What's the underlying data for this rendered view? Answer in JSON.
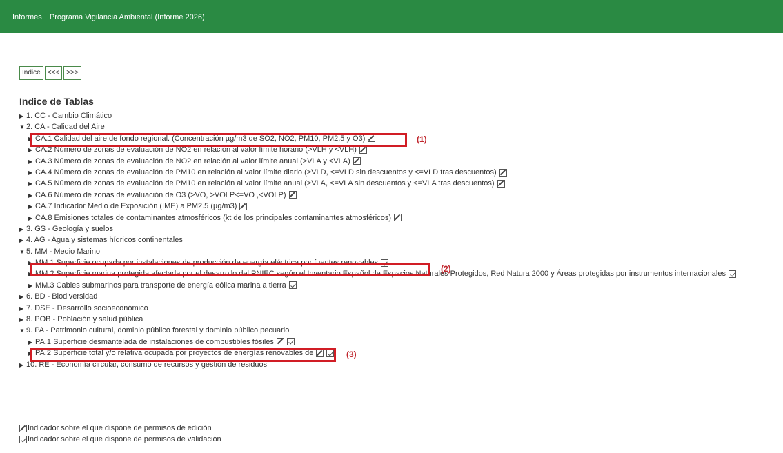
{
  "header": {
    "breadcrumb": [
      "Informes",
      "Programa Vigilancia Ambiental (Informe 2026)"
    ],
    "color": "#2a8a43"
  },
  "nav_buttons": [
    "Indice",
    "<<<",
    ">>>"
  ],
  "index_title": "Indice de Tablas",
  "tree": [
    {
      "level": 0,
      "expanded": false,
      "label": "1. CC - Cambio Climático"
    },
    {
      "level": 0,
      "expanded": true,
      "label": "2. CA - Calidad del Aire"
    },
    {
      "level": 1,
      "label": "CA.1 Calidad del aire de fondo regional. (Concentración µg/m3 de SO2, NO2, PM10, PM2,5 y O3)",
      "icons": [
        "edit"
      ]
    },
    {
      "level": 1,
      "label": "CA.2 Número de zonas de evaluación de NO2 en relación al valor límite horario (>VLH y <VLH)",
      "icons": [
        "edit"
      ]
    },
    {
      "level": 1,
      "label": "CA.3 Número de zonas de evaluación de NO2 en relación al valor límite anual (>VLA y <VLA)",
      "icons": [
        "edit"
      ]
    },
    {
      "level": 1,
      "label": "CA.4 Número de zonas de evaluación de PM10 en relación al valor límite diario (>VLD, <=VLD sin descuentos y <=VLD tras descuentos)",
      "icons": [
        "edit"
      ]
    },
    {
      "level": 1,
      "label": "CA.5 Número de zonas de evaluación de PM10 en relación al valor límite anual (>VLA, <=VLA sin descuentos y <=VLA tras descuentos)",
      "icons": [
        "edit"
      ]
    },
    {
      "level": 1,
      "label": "CA.6 Número de zonas de evaluación de O3 (>VO, >VOLP<=VO ,<VOLP)",
      "icons": [
        "edit"
      ]
    },
    {
      "level": 1,
      "label": "CA.7 Indicador Medio de Exposición (IME) a PM2.5 (µg/m3)",
      "icons": [
        "edit"
      ]
    },
    {
      "level": 1,
      "label": "CA.8 Emisiones totales de contaminantes atmosféricos (kt de los principales contaminantes atmosféricos)",
      "icons": [
        "edit"
      ]
    },
    {
      "level": 0,
      "expanded": false,
      "label": "3. GS - Geología y suelos"
    },
    {
      "level": 0,
      "expanded": false,
      "label": "4. AG - Agua y sistemas hídricos continentales"
    },
    {
      "level": 0,
      "expanded": true,
      "label": "5. MM - Medio Marino"
    },
    {
      "level": 1,
      "label": "MM.1 Superficie ocupada por instalaciones de producción de energía eléctrica por fuentes renovables",
      "icons": [
        "check"
      ]
    },
    {
      "level": 1,
      "label": "MM.2 Superficie marina protegida afectada por el desarrollo del PNIEC según el Inventario Español de Espacios Naturales Protegidos, Red Natura 2000 y Áreas protegidas por instrumentos internacionales",
      "icons": [
        "check"
      ]
    },
    {
      "level": 1,
      "label": "MM.3 Cables submarinos para transporte de energía eólica marina a tierra",
      "icons": [
        "check"
      ]
    },
    {
      "level": 0,
      "expanded": false,
      "label": "6. BD - Biodiversidad"
    },
    {
      "level": 0,
      "expanded": false,
      "label": "7. DSE - Desarrollo socioeconómico"
    },
    {
      "level": 0,
      "expanded": false,
      "label": "8. POB - Población y salud pública"
    },
    {
      "level": 0,
      "expanded": true,
      "label": "9. PA - Patrimonio cultural, dominio público forestal y dominio público pecuario"
    },
    {
      "level": 1,
      "label": "PA.1 Superficie desmantelada de instalaciones de combustibles fósiles",
      "icons": [
        "edit",
        "check"
      ]
    },
    {
      "level": 1,
      "label": "PA.2 Superficie total y/o relativa ocupada por proyectos de energías renovables de",
      "icons": [
        "edit",
        "check"
      ]
    },
    {
      "level": 0,
      "expanded": false,
      "label": "10. RE - Economía circular, consumo de recursos y gestión de residuos"
    }
  ],
  "annotations": [
    "(1)",
    "(2)",
    "(3)"
  ],
  "highlight_color": "#d11d25",
  "legend": {
    "edit": "Indicador sobre el que dispone de permisos de edición",
    "validate": "Indicador sobre el que dispone de permisos de validación"
  }
}
